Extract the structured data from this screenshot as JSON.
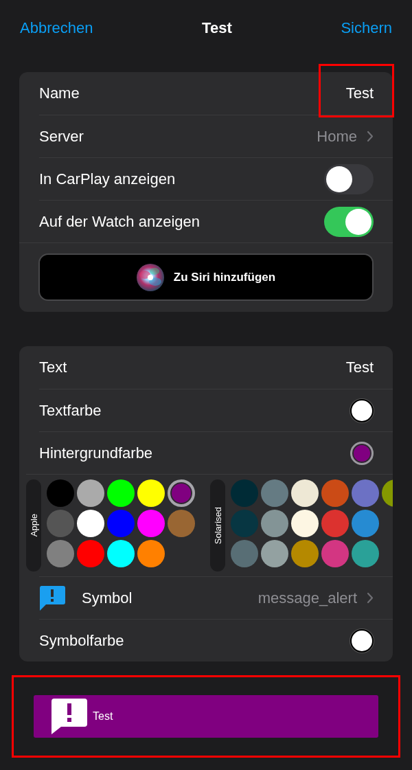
{
  "nav": {
    "cancel": "Abbrechen",
    "title": "Test",
    "save": "Sichern"
  },
  "general": {
    "rows": [
      {
        "kind": "text",
        "label": "Name",
        "value": "Test",
        "highlighted": true
      },
      {
        "kind": "link",
        "label": "Server",
        "value": "Home"
      },
      {
        "kind": "toggle",
        "label": "In CarPlay anzeigen",
        "on": false
      },
      {
        "kind": "toggle",
        "label": "Auf der Watch anzeigen",
        "on": true
      }
    ],
    "siri_button": "Zu Siri hinzufügen"
  },
  "appearance": {
    "rows": [
      {
        "kind": "text",
        "label": "Text",
        "value": "Test"
      },
      {
        "kind": "color",
        "label": "Textfarbe",
        "color": "#ffffff"
      },
      {
        "kind": "color",
        "label": "Hintergrundfarbe",
        "color": "#800080"
      },
      {
        "kind": "palettes",
        "palettes": [
          {
            "name": "Apple",
            "swatches": [
              {
                "color": "#000000",
                "selected": false
              },
              {
                "color": "#555555",
                "selected": false
              },
              {
                "color": "#808080",
                "selected": false
              },
              {
                "color": "#aaaaaa",
                "selected": false
              },
              {
                "color": "#ffffff",
                "selected": false
              },
              {
                "color": "#ff0000",
                "selected": false
              },
              {
                "color": "#00ff00",
                "selected": false
              },
              {
                "color": "#0000ff",
                "selected": false
              },
              {
                "color": "#00ffff",
                "selected": false
              },
              {
                "color": "#ffff00",
                "selected": false
              },
              {
                "color": "#ff00ff",
                "selected": false
              },
              {
                "color": "#ff8000",
                "selected": false
              },
              {
                "color": "#800080",
                "selected": true
              },
              {
                "color": "#996633",
                "selected": false
              }
            ]
          },
          {
            "name": "Solarised",
            "swatches": [
              {
                "color": "#002b36",
                "selected": false
              },
              {
                "color": "#073642",
                "selected": false
              },
              {
                "color": "#586e75",
                "selected": false
              },
              {
                "color": "#657b83",
                "selected": false
              },
              {
                "color": "#839496",
                "selected": false
              },
              {
                "color": "#93a1a1",
                "selected": false
              },
              {
                "color": "#eee8d5",
                "selected": false
              },
              {
                "color": "#fdf6e3",
                "selected": false
              },
              {
                "color": "#b58900",
                "selected": false
              },
              {
                "color": "#cb4b16",
                "selected": false
              },
              {
                "color": "#dc322f",
                "selected": false
              },
              {
                "color": "#d33682",
                "selected": false
              },
              {
                "color": "#6c71c4",
                "selected": false
              },
              {
                "color": "#268bd2",
                "selected": false
              },
              {
                "color": "#2aa198",
                "selected": false
              },
              {
                "color": "#859900",
                "selected": false
              }
            ]
          }
        ]
      },
      {
        "kind": "symbol",
        "label": "Symbol",
        "value": "message_alert"
      },
      {
        "kind": "color",
        "label": "Symbolfarbe",
        "color": "#ffffff"
      }
    ]
  },
  "preview": {
    "text": "Test",
    "highlighted": true
  }
}
